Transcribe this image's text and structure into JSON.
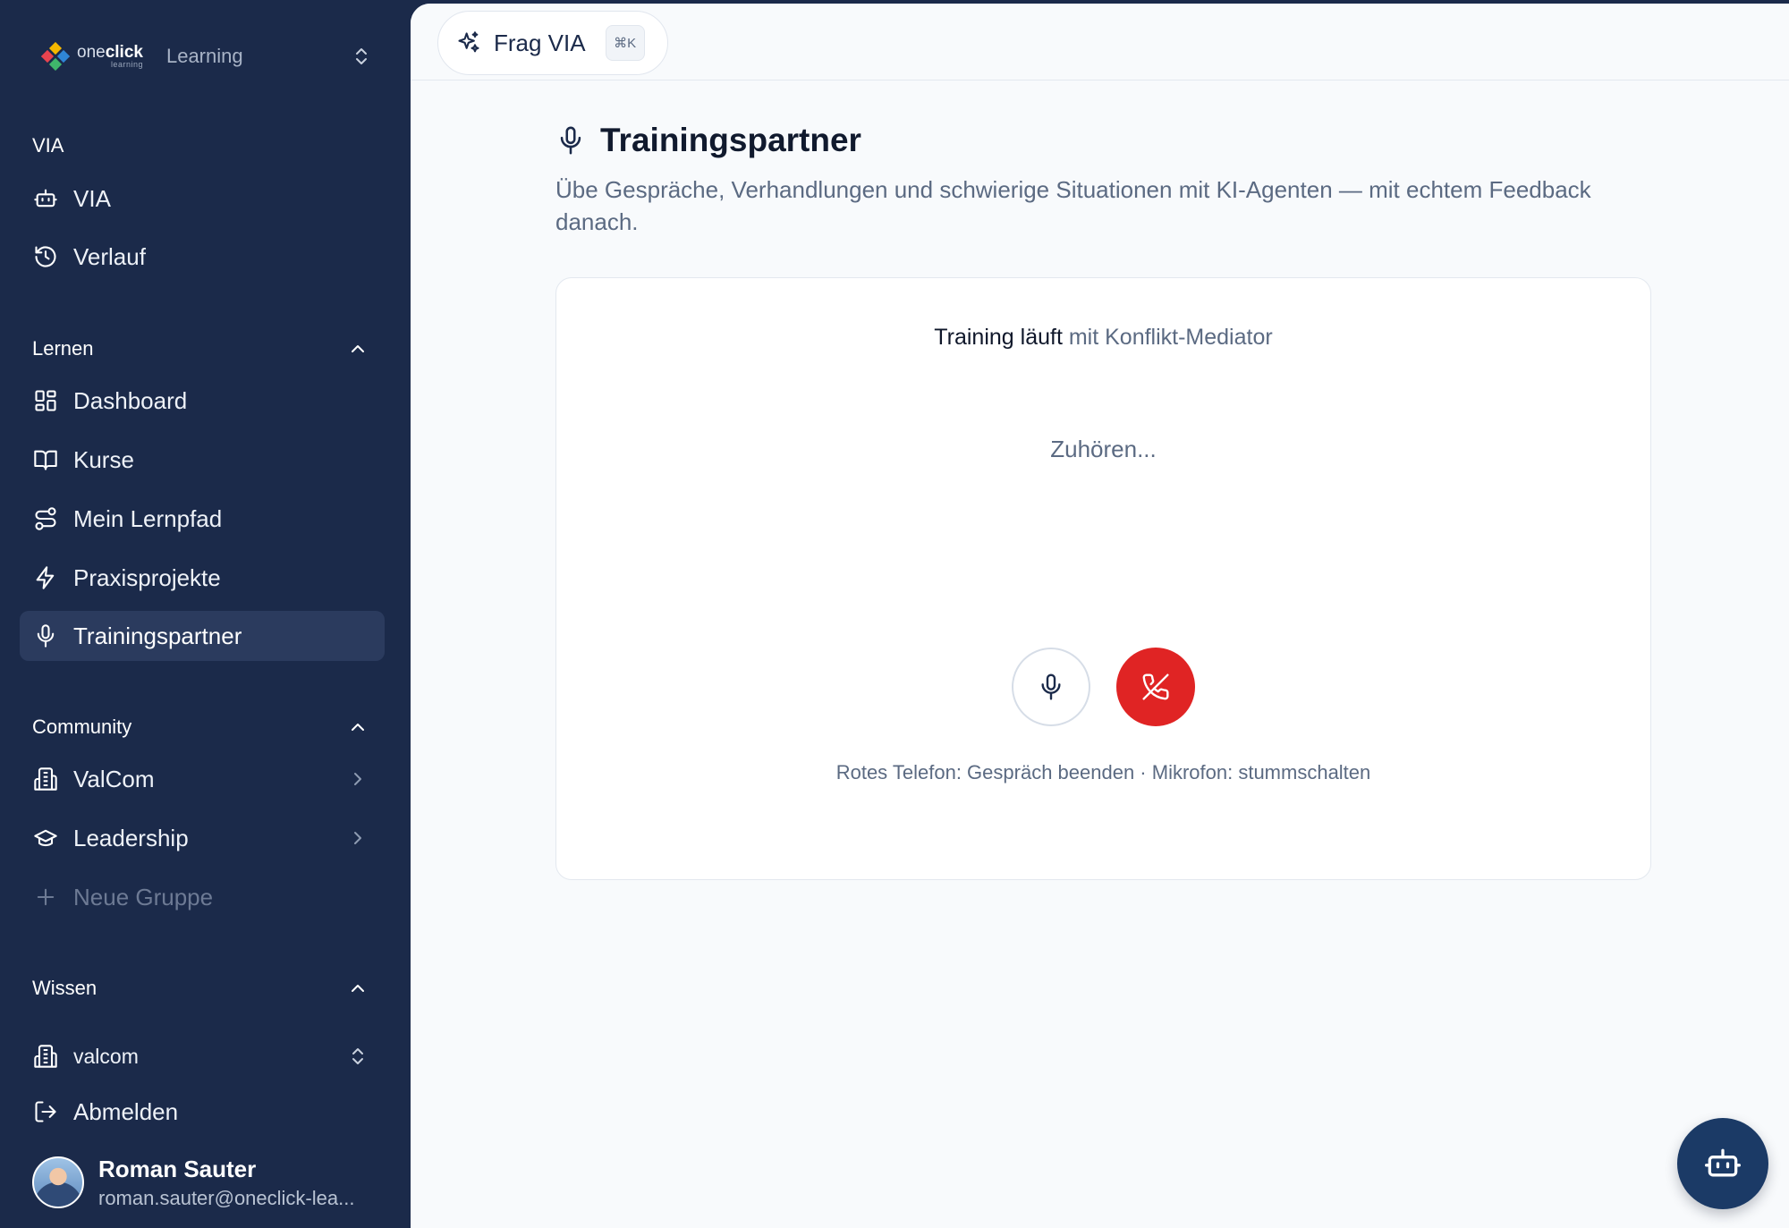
{
  "brand": {
    "logo_text_prefix": "one",
    "logo_text_bold": "click",
    "logo_text_sub": "learning",
    "label": "Learning"
  },
  "sidebar": {
    "via_section": {
      "title": "VIA",
      "items": [
        {
          "label": "VIA",
          "icon": "bot-icon"
        },
        {
          "label": "Verlauf",
          "icon": "history-icon"
        }
      ]
    },
    "lernen_section": {
      "title": "Lernen",
      "items": [
        {
          "label": "Dashboard",
          "icon": "dashboard-icon"
        },
        {
          "label": "Kurse",
          "icon": "book-icon"
        },
        {
          "label": "Mein Lernpfad",
          "icon": "route-icon"
        },
        {
          "label": "Praxisprojekte",
          "icon": "lightning-icon"
        },
        {
          "label": "Trainingspartner",
          "icon": "mic-icon",
          "active": true
        }
      ]
    },
    "community_section": {
      "title": "Community",
      "items": [
        {
          "label": "ValCom",
          "icon": "building-icon"
        },
        {
          "label": "Leadership",
          "icon": "graduation-cap-icon"
        },
        {
          "label": "Neue Gruppe",
          "icon": "plus-icon"
        }
      ]
    },
    "wissen_section": {
      "title": "Wissen",
      "workspace": "valcom",
      "logout": "Abmelden"
    }
  },
  "user": {
    "name": "Roman Sauter",
    "email": "roman.sauter@oneclick-lea..."
  },
  "topbar": {
    "frag_via_label": "Frag VIA",
    "shortcut": "⌘K"
  },
  "page": {
    "title": "Trainingspartner",
    "subtitle": "Übe Gespräche, Verhandlungen und schwierige Situationen mit KI-Agenten — mit echtem Feedback danach."
  },
  "session": {
    "status_prefix": "Training läuft",
    "status_partner": "mit Konflikt-Mediator",
    "listening": "Zuhören...",
    "hint": "Rotes Telefon: Gespräch beenden · Mikrofon: stummschalten"
  },
  "colors": {
    "sidebar_bg": "#1b2a4a",
    "active_item_bg": "#2b3b5e",
    "hangup_red": "#e02424",
    "fab_bg": "#1b3a66"
  }
}
